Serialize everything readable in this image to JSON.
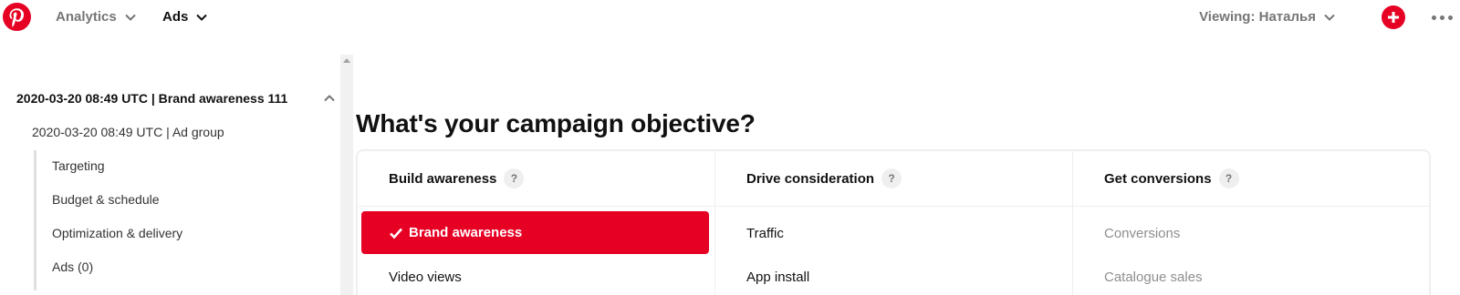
{
  "nav": {
    "analytics_label": "Analytics",
    "ads_label": "Ads",
    "viewing_label": "Viewing: Наталья",
    "brand_color": "#e60023",
    "icons": [
      "pinterest-logo-icon",
      "chevron-down-icon",
      "plus-icon",
      "more-icon"
    ]
  },
  "sidebar": {
    "campaign_label": "2020-03-20 08:49 UTC | Brand awareness 111",
    "adgroup_label": "2020-03-20 08:49 UTC | Ad group",
    "items": [
      {
        "label": "Targeting"
      },
      {
        "label": "Budget & schedule"
      },
      {
        "label": "Optimization & delivery"
      },
      {
        "label": "Ads (0)"
      }
    ]
  },
  "main": {
    "title": "What's your campaign objective?",
    "help_glyph": "?",
    "columns": [
      {
        "header": "Build awareness",
        "options": [
          {
            "label": "Brand awareness",
            "selected": true
          },
          {
            "label": "Video views",
            "selected": false
          }
        ]
      },
      {
        "header": "Drive consideration",
        "options": [
          {
            "label": "Traffic",
            "selected": false
          },
          {
            "label": "App install",
            "selected": false
          }
        ]
      },
      {
        "header": "Get conversions",
        "options": [
          {
            "label": "Conversions",
            "selected": false,
            "disabled": true
          },
          {
            "label": "Catalogue sales",
            "selected": false,
            "disabled": true
          }
        ]
      }
    ]
  }
}
